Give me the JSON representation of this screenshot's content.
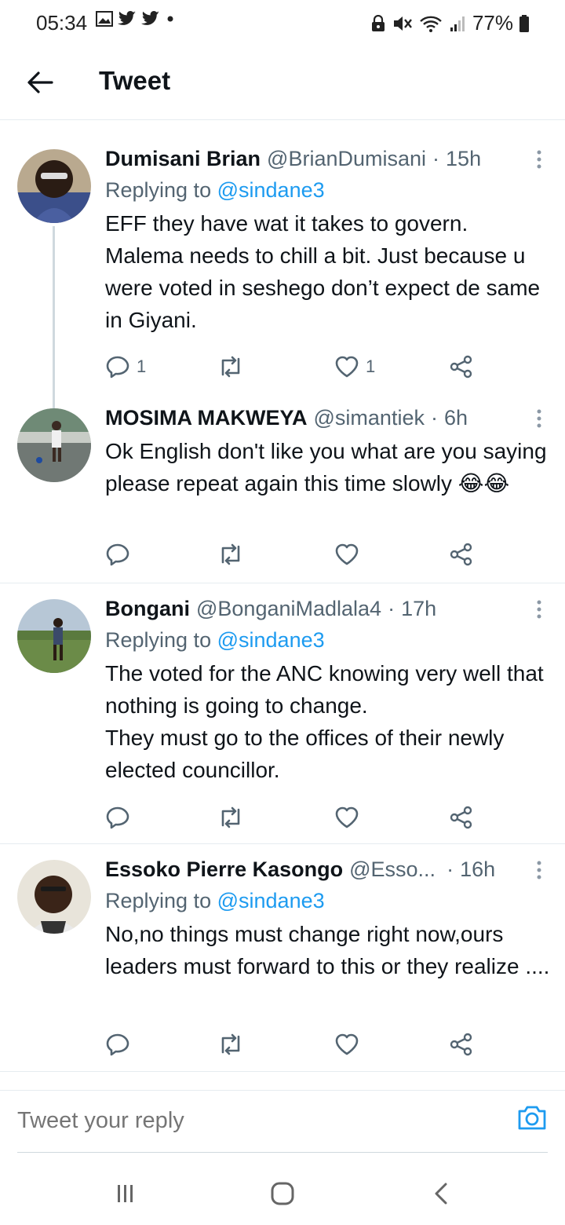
{
  "status_bar": {
    "time": "05:34",
    "left_icons": [
      "image-icon",
      "twitter-icon",
      "twitter-icon",
      "dot-icon"
    ],
    "right_icons": [
      "lock-icon",
      "mute-icon",
      "wifi-icon",
      "signal-icon"
    ],
    "battery": "77%"
  },
  "header": {
    "title": "Tweet",
    "back_icon": "arrow-left-icon"
  },
  "tweets": [
    {
      "name": "Dumisani Brian",
      "handle": "@BrianDumisani",
      "sep": "·",
      "time": "15h",
      "replying_prefix": "Replying to",
      "replying_to": "@sindane3",
      "text": "EFF they have wat it takes to govern. Malema needs to chill a bit. Just because u were voted in seshego don’t expect de same in Giyani.",
      "reply_count": "1",
      "retweet_count": "",
      "like_count": "1"
    },
    {
      "name": "MOSIMA MAKWEYA",
      "handle": "@simantiek",
      "sep": "·",
      "time": "6h",
      "text": "Ok  English don't like you what are you saying please repeat again this time slowly 😂😂",
      "reply_count": "",
      "retweet_count": "",
      "like_count": ""
    },
    {
      "name": "Bongani",
      "handle": "@BonganiMadlala4",
      "sep": "·",
      "time": "17h",
      "replying_prefix": "Replying to",
      "replying_to": "@sindane3",
      "text_line1": "The voted for the ANC knowing very well that nothing is going to change.",
      "text_line2": "They must go to the offices of their newly elected councillor.",
      "reply_count": "",
      "retweet_count": "",
      "like_count": ""
    },
    {
      "name": "Essoko Pierre Kasongo",
      "handle": "@Esso...",
      "sep": "·",
      "time": "16h",
      "replying_prefix": "Replying to",
      "replying_to": "@sindane3",
      "text": "No,no things must change right now,ours leaders must forward to this or they realize ....",
      "reply_count": "",
      "retweet_count": "",
      "like_count": ""
    }
  ],
  "reply_bar": {
    "placeholder": "Tweet your reply",
    "camera_icon": "camera-icon"
  },
  "nav_bar": {
    "icons": [
      "recents-icon",
      "home-icon",
      "back-icon"
    ]
  },
  "colors": {
    "accent": "#1d9bf0",
    "text": "#0f1419",
    "secondary": "#536471",
    "divider": "#e6ecf0"
  }
}
